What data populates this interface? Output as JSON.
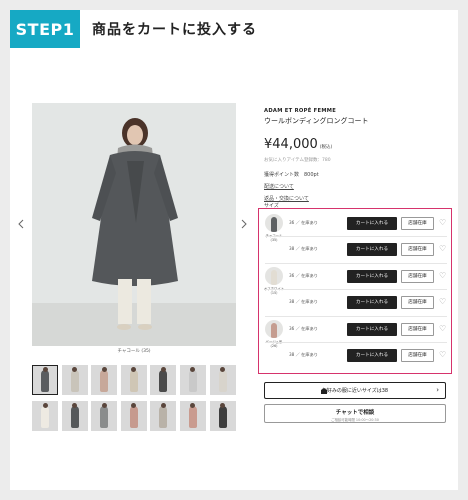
{
  "header": {
    "step_label": "STEP1",
    "title": "商品をカートに投入する"
  },
  "gallery": {
    "prev_icon": "chevron-left-icon",
    "next_icon": "chevron-right-icon",
    "caption": "チャコール (35)",
    "thumb_colors": [
      "#5a5d60",
      "#c9c4ba",
      "#c7a89a",
      "#cfc6b5",
      "#4b4b4b",
      "#c9c9c9",
      "#d8d4cc",
      "#eeeae2",
      "#55585a",
      "#8a8c8c",
      "#c69a8e",
      "#b9b2a8",
      "#c99b8f",
      "#3e3e3e"
    ]
  },
  "product": {
    "brand": "ADAM ET ROPÉ FEMME",
    "name": "ウールボンディングロングコート",
    "price": "¥44,000",
    "tax": "(税込)",
    "fav_count": "お気に入りアイテム登録数：780",
    "points": "獲得ポイント数　800pt",
    "link_delivery": "配送について",
    "link_returns": "返品・交換について"
  },
  "sizes": {
    "label": "サイズ",
    "add_to_cart": "カートに入れる",
    "store_stock": "店舗在庫",
    "colors": [
      {
        "name": "チャコール (35)",
        "swatch": "#5e6163",
        "rows": [
          {
            "stock": "36 ／ 在庫あり"
          },
          {
            "stock": "38 ／ 在庫あり"
          }
        ]
      },
      {
        "name": "オフホワイト（15）",
        "swatch": "#e2ddd3",
        "rows": [
          {
            "stock": "36 ／ 在庫あり"
          },
          {
            "stock": "38 ／ 在庫あり"
          }
        ]
      },
      {
        "name": "ベージュ系 (26)",
        "swatch": "#c59d90",
        "rows": [
          {
            "stock": "36 ／ 在庫あり"
          },
          {
            "stock": "38 ／ 在庫あり"
          }
        ]
      }
    ]
  },
  "actions": {
    "size_hint": "お好みの服に近いサイズは38",
    "chat_label": "チャットで相談",
    "chat_hours": "ご相談可能時間 10:00〜20:30"
  }
}
